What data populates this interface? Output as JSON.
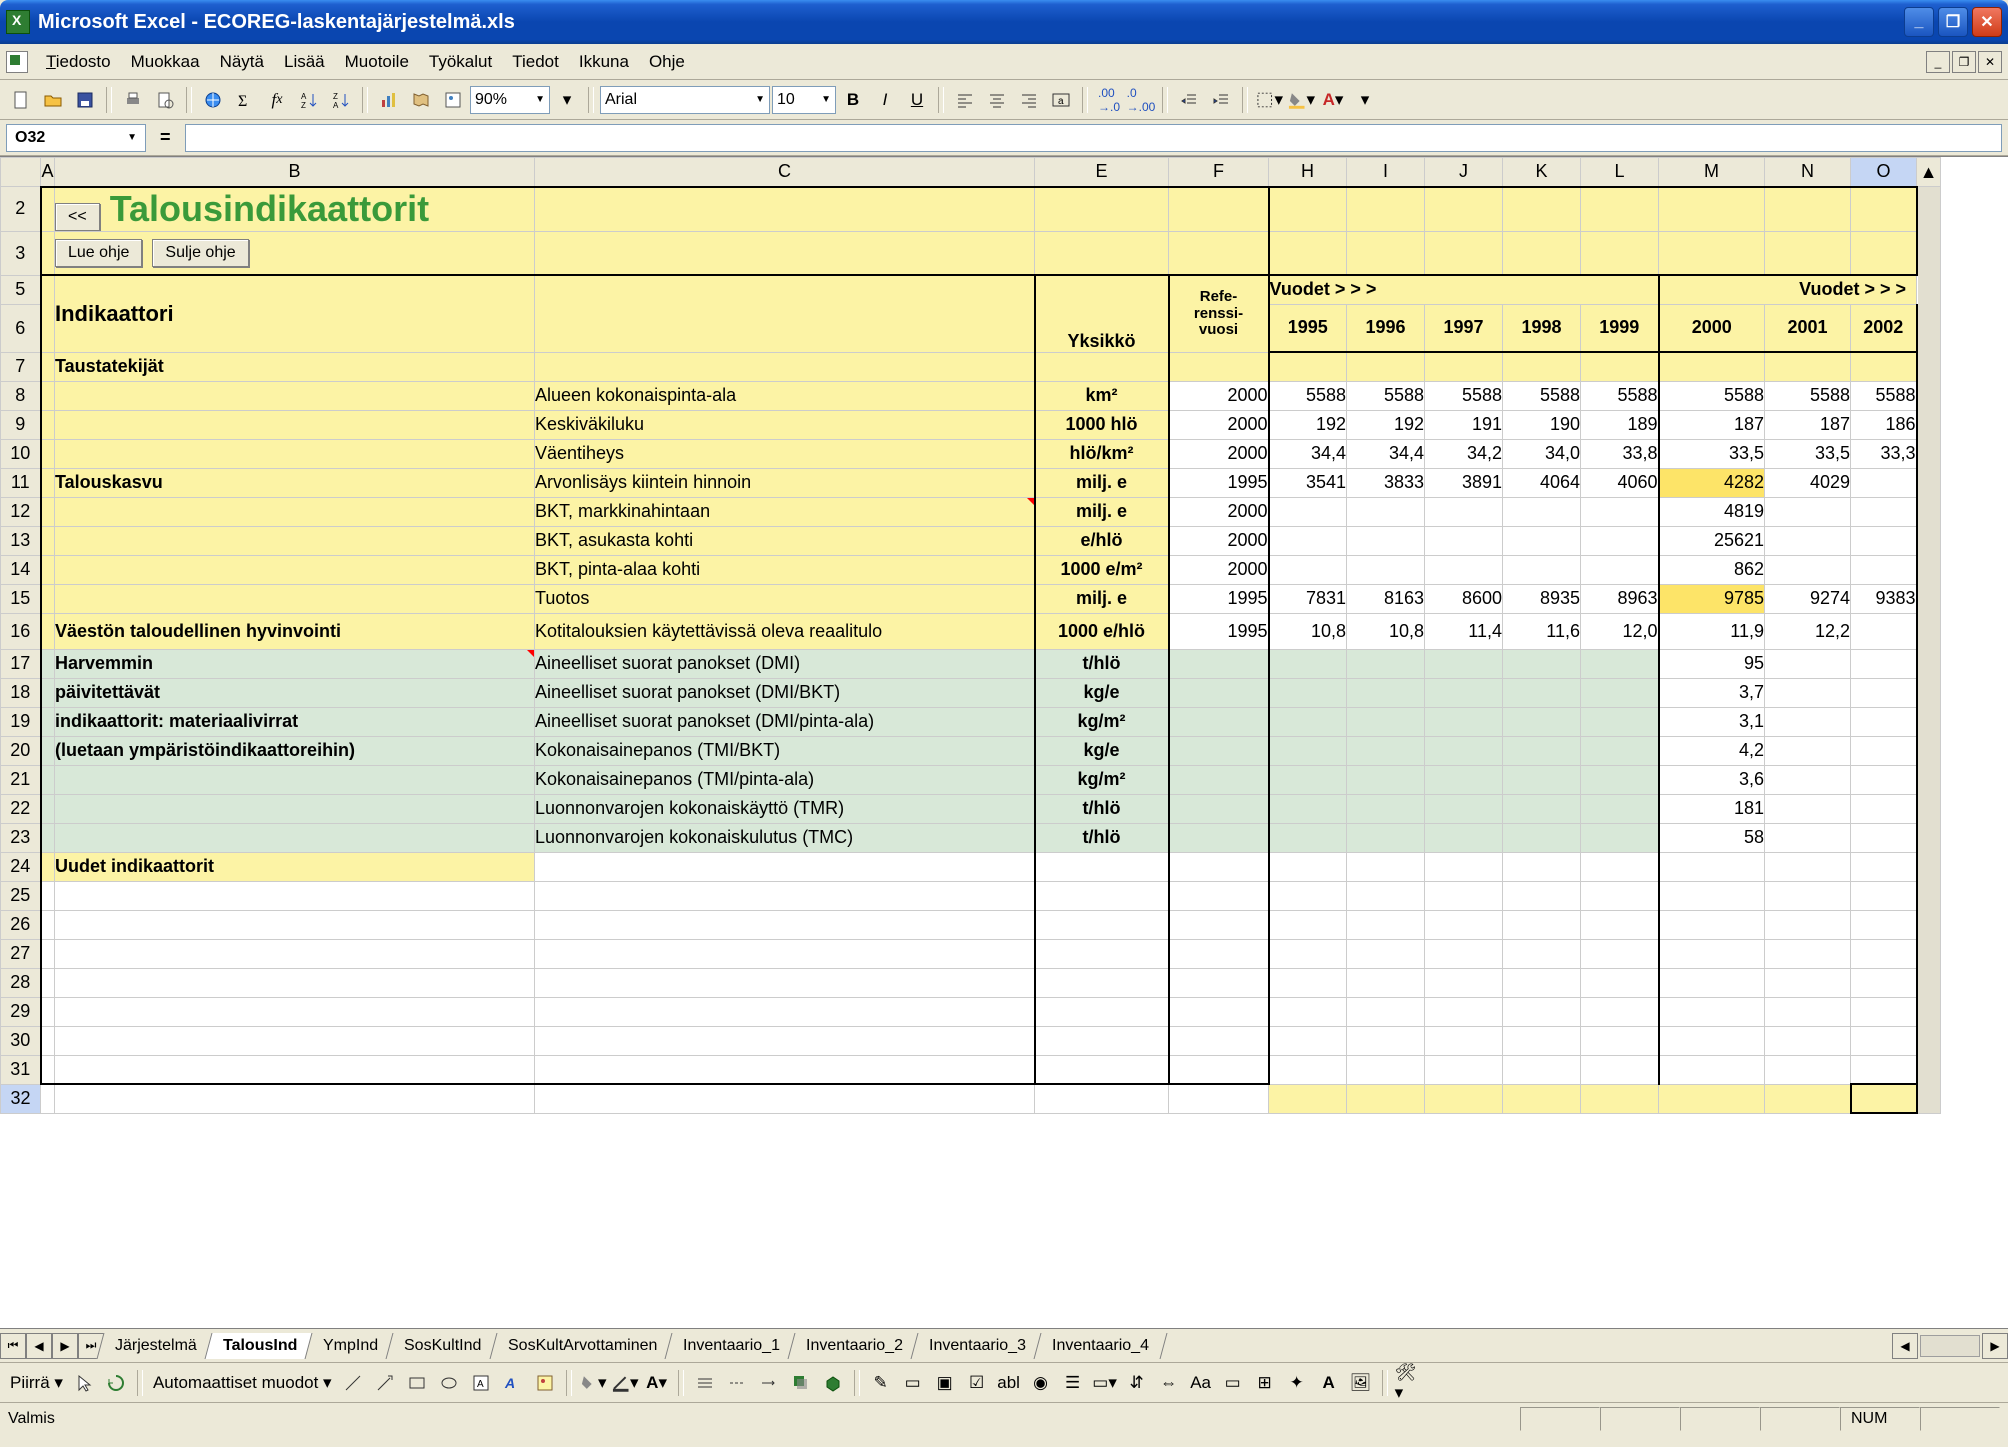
{
  "app": {
    "title": "Microsoft Excel - ECOREG-laskentajärjestelmä.xls"
  },
  "menus": {
    "file": "Tiedosto",
    "edit": "Muokkaa",
    "view": "Näytä",
    "insert": "Lisää",
    "format": "Muotoile",
    "tools": "Työkalut",
    "data": "Tiedot",
    "window": "Ikkuna",
    "help": "Ohje"
  },
  "toolbar": {
    "zoom": "90%",
    "font": "Arial",
    "size": "10"
  },
  "namebox": "O32",
  "formula_label": "=",
  "content": {
    "back_btn": "<<",
    "title": "Talousindikaattorit",
    "lue_ohje": "Lue ohje",
    "sulje_ohje": "Sulje ohje",
    "header_ind": "Indikaattori",
    "header_unit": "Yksikkö",
    "header_ref": "Refe-renssi-vuosi",
    "vuodet_label": "Vuodet > > >",
    "years": {
      "y1995": "1995",
      "y1996": "1996",
      "y1997": "1997",
      "y1998": "1998",
      "y1999": "1999",
      "y2000": "2000",
      "y2001": "2001",
      "y2002": "2002"
    }
  },
  "rows": {
    "r7": {
      "group": "Taustatekijät"
    },
    "r8": {
      "c": "Alueen kokonaispinta-ala",
      "e": "km²",
      "f": "2000",
      "h": "5588",
      "i": "5588",
      "j": "5588",
      "k": "5588",
      "l": "5588",
      "m": "5588",
      "n": "5588",
      "o": "5588"
    },
    "r9": {
      "c": "Keskiväkiluku",
      "e": "1000 hlö",
      "f": "2000",
      "h": "192",
      "i": "192",
      "j": "191",
      "k": "190",
      "l": "189",
      "m": "187",
      "n": "187",
      "o": "186"
    },
    "r10": {
      "c": "Väentiheys",
      "e": "hlö/km²",
      "f": "2000",
      "h": "34,4",
      "i": "34,4",
      "j": "34,2",
      "k": "34,0",
      "l": "33,8",
      "m": "33,5",
      "n": "33,5",
      "o": "33,3"
    },
    "r11": {
      "group": "Talouskasvu",
      "c": "Arvonlisäys kiintein hinnoin",
      "e": "milj. e",
      "f": "1995",
      "h": "3541",
      "i": "3833",
      "j": "3891",
      "k": "4064",
      "l": "4060",
      "m": "4282",
      "n": "4029",
      "o": ""
    },
    "r12": {
      "c": "BKT, markkinahintaan",
      "e": "milj. e",
      "f": "2000",
      "m": "4819"
    },
    "r13": {
      "c": "BKT, asukasta kohti",
      "e": "e/hlö",
      "f": "2000",
      "m": "25621"
    },
    "r14": {
      "c": "BKT, pinta-alaa kohti",
      "e": "1000 e/m²",
      "f": "2000",
      "m": "862"
    },
    "r15": {
      "c": "Tuotos",
      "e": "milj. e",
      "f": "1995",
      "h": "7831",
      "i": "8163",
      "j": "8600",
      "k": "8935",
      "l": "8963",
      "m": "9785",
      "n": "9274",
      "o": "9383"
    },
    "r16": {
      "group": "Väestön taloudellinen hyvinvointi",
      "c": "Kotitalouksien käytettävissä oleva reaalitulo",
      "e": "1000 e/hlö",
      "f": "1995",
      "h": "10,8",
      "i": "10,8",
      "j": "11,4",
      "k": "11,6",
      "l": "12,0",
      "m": "11,9",
      "n": "12,2",
      "o": ""
    },
    "r17": {
      "group": "Harvemmin",
      "c": "Aineelliset suorat panokset (DMI)",
      "e": "t/hlö",
      "m": "95"
    },
    "r18": {
      "group": "päivitettävät",
      "c": "Aineelliset suorat panokset (DMI/BKT)",
      "e": "kg/e",
      "m": "3,7"
    },
    "r19": {
      "group": "indikaattorit: materiaalivirrat",
      "c": "Aineelliset suorat panokset (DMI/pinta-ala)",
      "e": "kg/m²",
      "m": "3,1"
    },
    "r20": {
      "group": "(luetaan ympäristöindikaattoreihin)",
      "c": "Kokonaisainepanos (TMI/BKT)",
      "e": "kg/e",
      "m": "4,2"
    },
    "r21": {
      "c": "Kokonaisainepanos (TMI/pinta-ala)",
      "e": "kg/m²",
      "m": "3,6"
    },
    "r22": {
      "c": "Luonnonvarojen kokonaiskäyttö (TMR)",
      "e": "t/hlö",
      "m": "181"
    },
    "r23": {
      "c": "Luonnonvarojen kokonaiskulutus (TMC)",
      "e": "t/hlö",
      "m": "58"
    },
    "r24": {
      "group": "Uudet indikaattorit"
    }
  },
  "tabs": {
    "t1": "Järjestelmä",
    "t2": "TalousInd",
    "t3": "YmpInd",
    "t4": "SosKultInd",
    "t5": "SosKultArvottaminen",
    "t6": "Inventaario_1",
    "t7": "Inventaario_2",
    "t8": "Inventaario_3",
    "t9": "Inventaario_4"
  },
  "bottom": {
    "piirra": "Piirrä ",
    "automuodot": "Automaattiset muodot "
  },
  "status": {
    "ready": "Valmis",
    "num": "NUM"
  }
}
